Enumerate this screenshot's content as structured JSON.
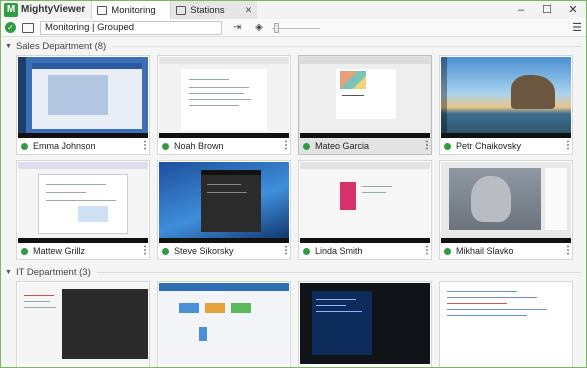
{
  "app": {
    "title": "MightyViewer",
    "logo_letter": "M"
  },
  "tabs": [
    {
      "label": "Monitoring",
      "active": true
    },
    {
      "label": "Stations",
      "active": false
    }
  ],
  "toolbar": {
    "view_value": "Monitoring | Grouped"
  },
  "groups": [
    {
      "label": "Sales Department (8)",
      "stations": [
        {
          "name": "Emma Johnson",
          "status": "online",
          "thumb": "desktop-blue"
        },
        {
          "name": "Noah Brown",
          "status": "online",
          "thumb": "document"
        },
        {
          "name": "Mateo Garcia",
          "status": "online",
          "thumb": "slides",
          "selected": true
        },
        {
          "name": "Petr Chaikovsky",
          "status": "online",
          "thumb": "beach"
        },
        {
          "name": "Mattew Grillz",
          "status": "online",
          "thumb": "browser-white"
        },
        {
          "name": "Steve Sikorsky",
          "status": "online",
          "thumb": "dark-app"
        },
        {
          "name": "Linda Smith",
          "status": "online",
          "thumb": "web-page"
        },
        {
          "name": "Mikhail Slavko",
          "status": "online",
          "thumb": "cat-photo"
        }
      ]
    },
    {
      "label": "IT Department (3)",
      "stations": [
        {
          "thumb": "code-dark"
        },
        {
          "thumb": "dashboard"
        },
        {
          "thumb": "terminal"
        },
        {
          "thumb": "code-light"
        }
      ]
    }
  ],
  "colors": {
    "accent": "#2e9c3f",
    "status_online": "#2e9c3f",
    "window_border": "#7bb661"
  }
}
